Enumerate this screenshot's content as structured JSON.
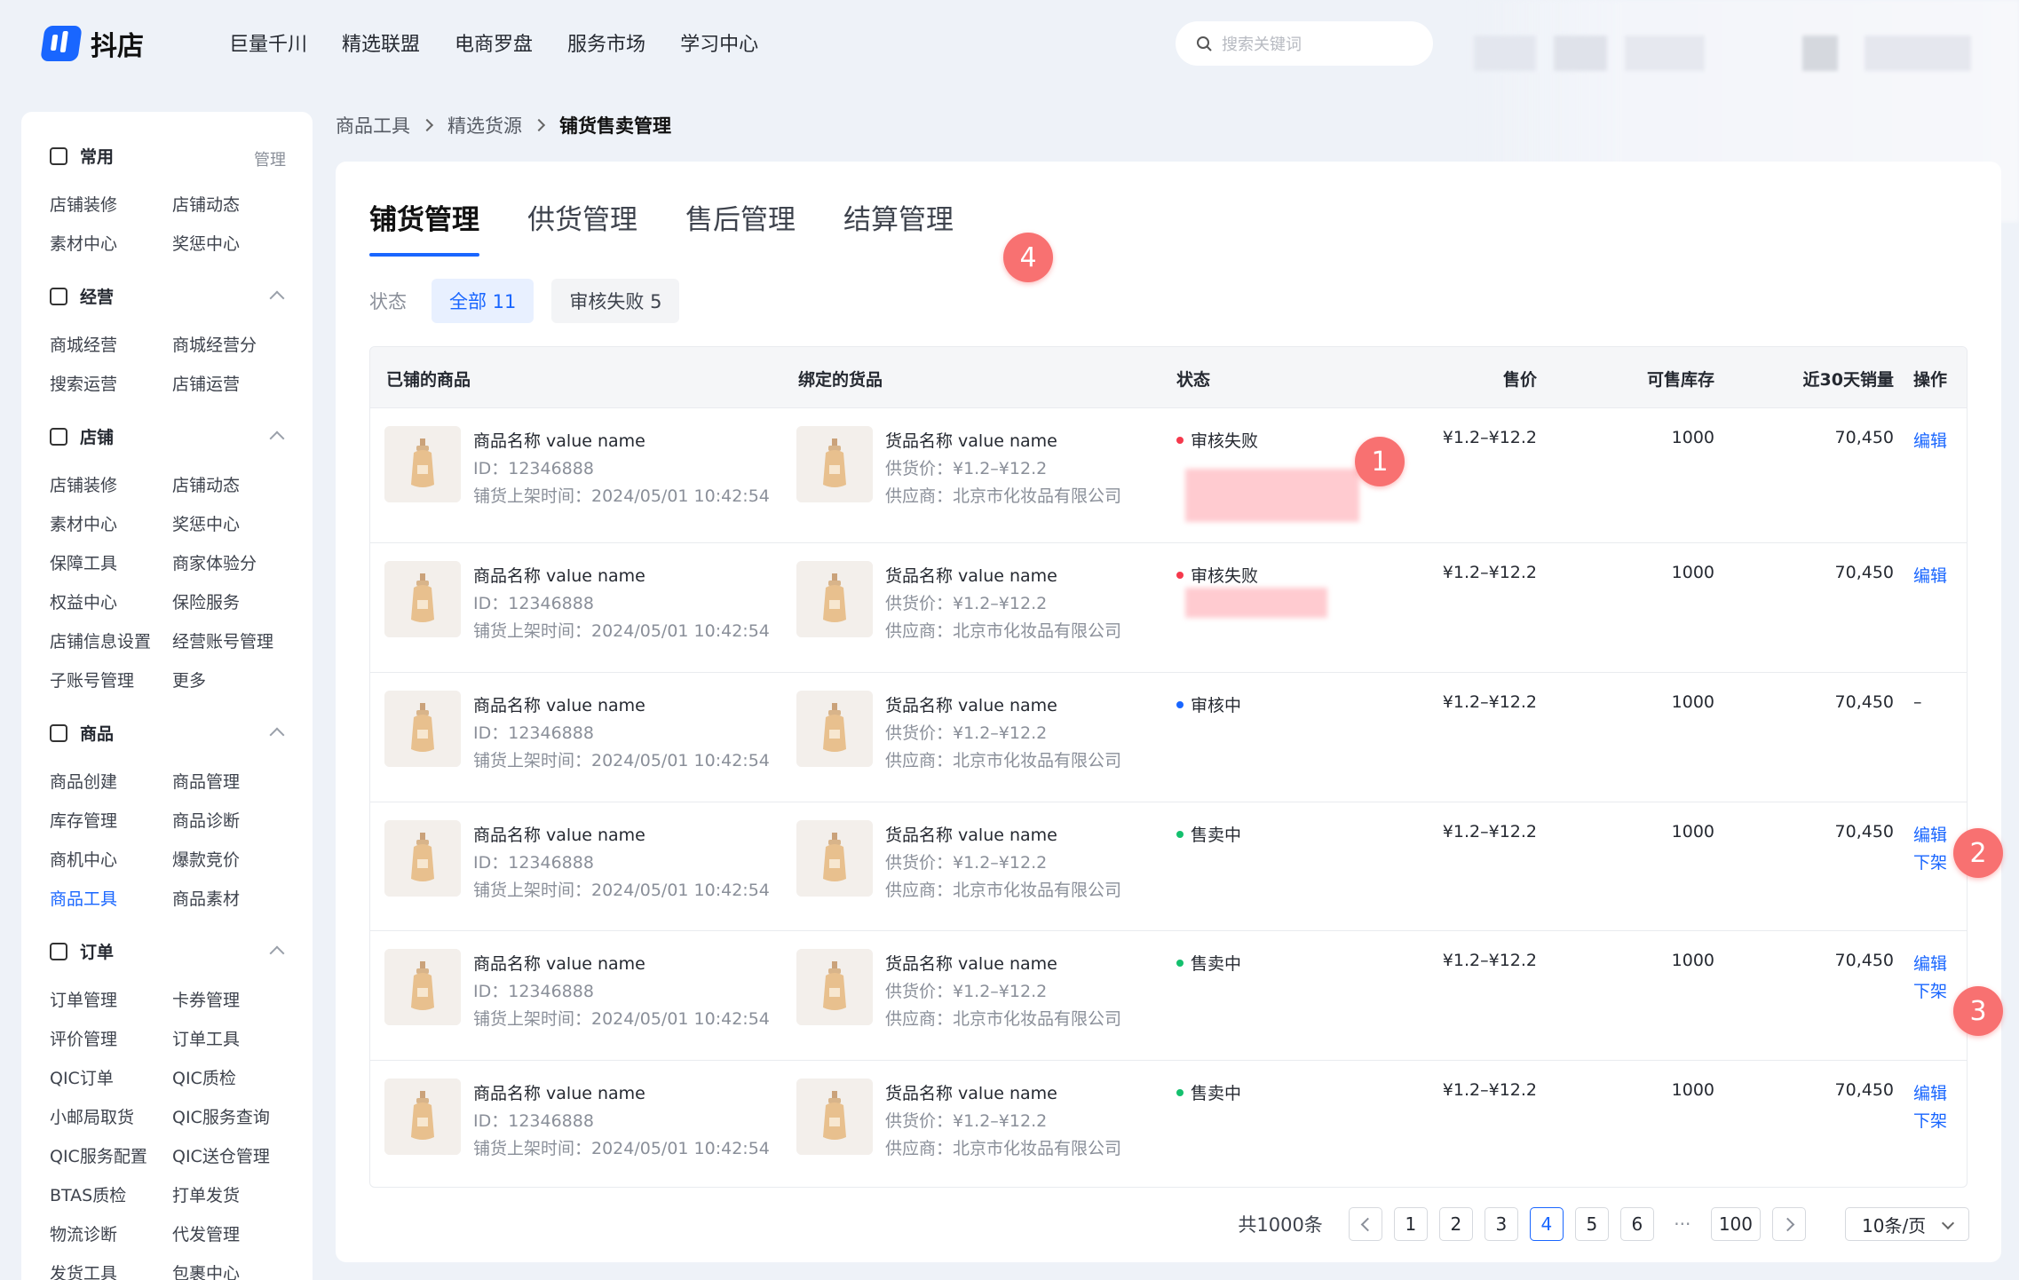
{
  "app": {
    "name": "抖店"
  },
  "topnav": [
    "巨量千川",
    "精选联盟",
    "电商罗盘",
    "服务市场",
    "学习中心"
  ],
  "search": {
    "placeholder": "搜索关键词"
  },
  "sidebar": {
    "sections": [
      {
        "title": "常用",
        "action": "管理",
        "items": [
          "店铺装修",
          "店铺动态",
          "素材中心",
          "奖惩中心"
        ]
      },
      {
        "title": "经营",
        "items": [
          "商城经营",
          "商城经营分",
          "搜索运营",
          "店铺运营"
        ]
      },
      {
        "title": "店铺",
        "items": [
          "店铺装修",
          "店铺动态",
          "素材中心",
          "奖惩中心",
          "保障工具",
          "商家体验分",
          "权益中心",
          "保险服务",
          "店铺信息设置",
          "经营账号管理",
          "子账号管理",
          "更多"
        ]
      },
      {
        "title": "商品",
        "items": [
          "商品创建",
          "商品管理",
          "库存管理",
          "商品诊断",
          "商机中心",
          "爆款竞价",
          "商品工具",
          "商品素材"
        ]
      },
      {
        "title": "订单",
        "items": [
          "订单管理",
          "卡券管理",
          "评价管理",
          "订单工具",
          "QIC订单",
          "QIC质检",
          "小邮局取货",
          "QIC服务查询",
          "QIC服务配置",
          "QIC送仓管理",
          "BTAS质检",
          "打单发货",
          "物流诊断",
          "代发管理",
          "发货工具",
          "包裹中心"
        ]
      }
    ]
  },
  "breadcrumb": [
    "商品工具",
    "精选货源",
    "铺货售卖管理"
  ],
  "tabs": [
    "铺货管理",
    "供货管理",
    "售后管理",
    "结算管理"
  ],
  "filters": {
    "label": "状态",
    "chips": [
      "全部 11",
      "审核失败 5"
    ]
  },
  "table": {
    "headers": [
      "已铺的商品",
      "绑定的货品",
      "状态",
      "售价",
      "可售库存",
      "近30天销量",
      "操作"
    ],
    "rows": [
      {
        "name": "商品名称 value name",
        "id": "ID：12346888",
        "time": "铺货上架时间：2024/05/01 10:42:54",
        "goods": "货品名称 value name",
        "supply_price": "供货价：¥1.2–¥12.2",
        "supplier": "供应商：北京市化妆品有限公司",
        "status": "审核失败",
        "status_color": "#f5394c",
        "price": "¥1.2–¥12.2",
        "stock": "1000",
        "sales": "70,450",
        "ops": [
          "编辑"
        ]
      },
      {
        "name": "商品名称 value name",
        "id": "ID：12346888",
        "time": "铺货上架时间：2024/05/01 10:42:54",
        "goods": "货品名称 value name",
        "supply_price": "供货价：¥1.2–¥12.2",
        "supplier": "供应商：北京市化妆品有限公司",
        "status": "审核失败",
        "status_color": "#f5394c",
        "price": "¥1.2–¥12.2",
        "stock": "1000",
        "sales": "70,450",
        "ops": [
          "编辑"
        ]
      },
      {
        "name": "商品名称 value name",
        "id": "ID：12346888",
        "time": "铺货上架时间：2024/05/01 10:42:54",
        "goods": "货品名称 value name",
        "supply_price": "供货价：¥1.2–¥12.2",
        "supplier": "供应商：北京市化妆品有限公司",
        "status": "审核中",
        "status_color": "#1966ff",
        "price": "¥1.2–¥12.2",
        "stock": "1000",
        "sales": "70,450",
        "ops": [
          "–"
        ]
      },
      {
        "name": "商品名称 value name",
        "id": "ID：12346888",
        "time": "铺货上架时间：2024/05/01 10:42:54",
        "goods": "货品名称 value name",
        "supply_price": "供货价：¥1.2–¥12.2",
        "supplier": "供应商：北京市化妆品有限公司",
        "status": "售卖中",
        "status_color": "#14c06e",
        "price": "¥1.2–¥12.2",
        "stock": "1000",
        "sales": "70,450",
        "ops": [
          "编辑",
          "下架"
        ]
      },
      {
        "name": "商品名称 value name",
        "id": "ID：12346888",
        "time": "铺货上架时间：2024/05/01 10:42:54",
        "goods": "货品名称 value name",
        "supply_price": "供货价：¥1.2–¥12.2",
        "supplier": "供应商：北京市化妆品有限公司",
        "status": "售卖中",
        "status_color": "#14c06e",
        "price": "¥1.2–¥12.2",
        "stock": "1000",
        "sales": "70,450",
        "ops": [
          "编辑",
          "下架"
        ]
      },
      {
        "name": "商品名称 value name",
        "id": "ID：12346888",
        "time": "铺货上架时间：2024/05/01 10:42:54",
        "goods": "货品名称 value name",
        "supply_price": "供货价：¥1.2–¥12.2",
        "supplier": "供应商：北京市化妆品有限公司",
        "status": "售卖中",
        "status_color": "#14c06e",
        "price": "¥1.2–¥12.2",
        "stock": "1000",
        "sales": "70,450",
        "ops": [
          "编辑",
          "下架"
        ]
      }
    ]
  },
  "badges": [
    "1",
    "2",
    "3",
    "4"
  ],
  "pagination": {
    "total": "共1000条",
    "pages": [
      "1",
      "2",
      "3",
      "4",
      "5",
      "6"
    ],
    "current": "4",
    "ellipsis": "···",
    "last": "100",
    "page_size": "10条/页"
  },
  "colors": {
    "accent": "#1966ff",
    "badge": "#f87171"
  }
}
